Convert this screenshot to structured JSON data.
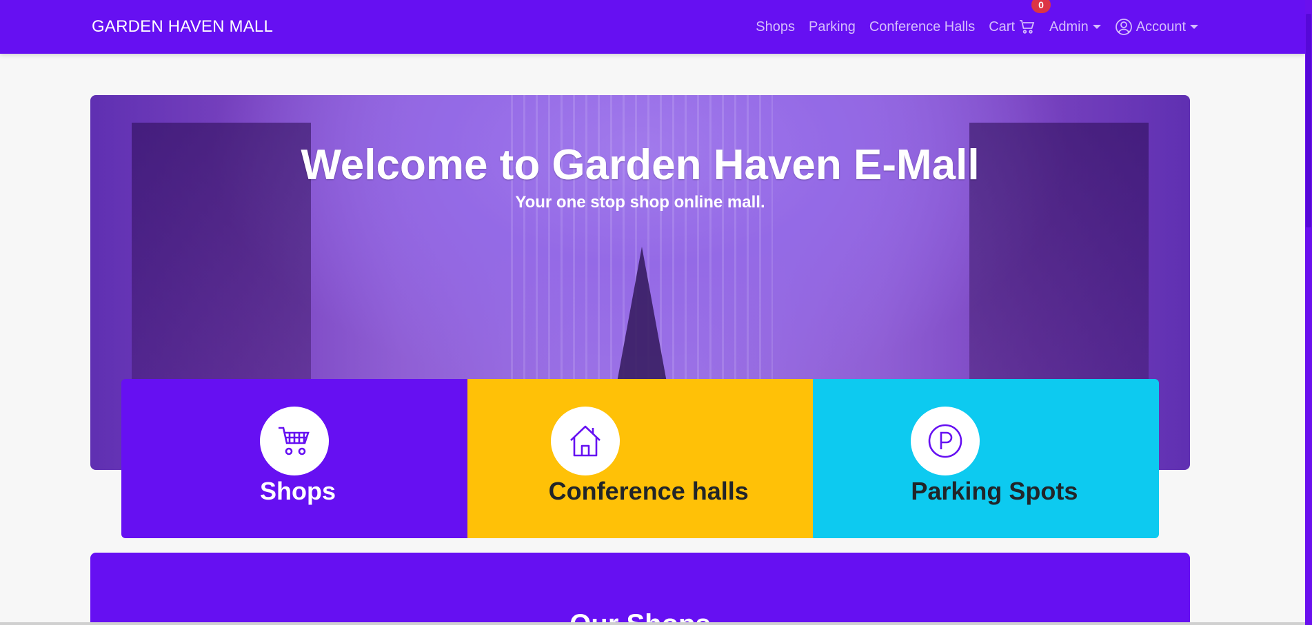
{
  "navbar": {
    "brand": "GARDEN HAVEN MALL",
    "links": [
      {
        "label": "Shops"
      },
      {
        "label": "Parking"
      },
      {
        "label": "Conference Halls"
      }
    ],
    "cart": {
      "label": "Cart",
      "count": "0",
      "icon": "cart-icon"
    },
    "admin": {
      "label": "Admin"
    },
    "account": {
      "label": "Account",
      "icon": "user-circle-icon"
    }
  },
  "hero": {
    "title": "Welcome to Garden Haven E-Mall",
    "subtitle": "Your one stop shop online mall."
  },
  "tiles": [
    {
      "label": "Shops",
      "icon": "shopping-cart-icon",
      "color": "#6610f2"
    },
    {
      "label": "Conference halls",
      "icon": "house-icon",
      "color": "#ffc107"
    },
    {
      "label": "Parking Spots",
      "icon": "parking-icon",
      "color": "#0dcaf0"
    }
  ],
  "our_shops": {
    "title": "Our Shops"
  },
  "colors": {
    "primary": "#6610f2",
    "warning": "#ffc107",
    "info": "#0dcaf0",
    "badge": "#dc3545",
    "background": "#f7f7f7"
  }
}
